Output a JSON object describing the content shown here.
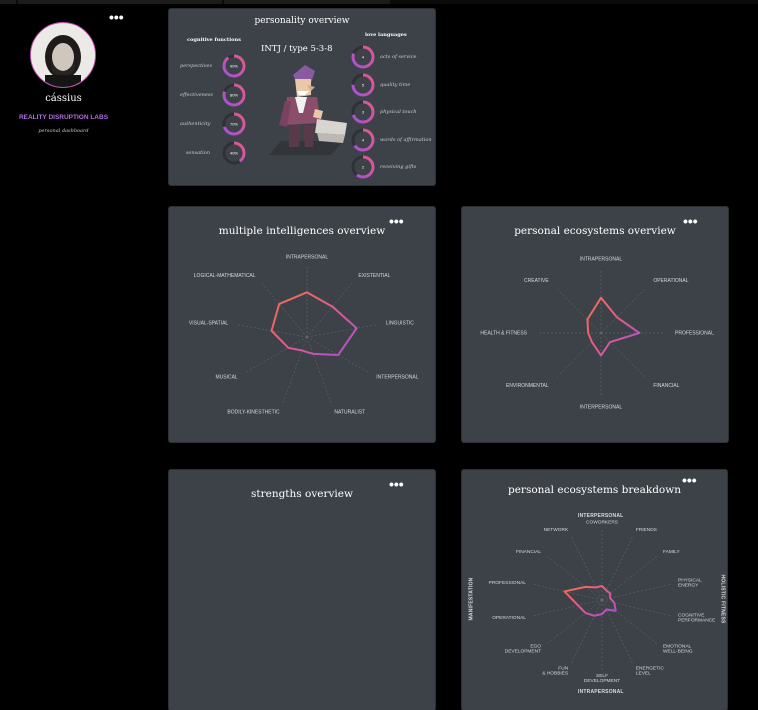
{
  "profile": {
    "name": "cássius",
    "organization": "REALITY DISRUPTION LABS",
    "subtitle": "personal dashboard",
    "menu_icon": "more-dots-icon"
  },
  "personality": {
    "title": "personality overview",
    "type_label": "INTJ / type 5-3-8",
    "cognitive_header": "cognitive functions",
    "cognitive": [
      {
        "label": "perspectives",
        "value": "90%",
        "fraction": 0.9
      },
      {
        "label": "effectiveness",
        "value": "80%",
        "fraction": 0.8
      },
      {
        "label": "authenticity",
        "value": "70%",
        "fraction": 0.7
      },
      {
        "label": "sensation",
        "value": "40%",
        "fraction": 0.4
      }
    ],
    "love_header": "love languages",
    "love": [
      {
        "label": "acts of service",
        "value": "4",
        "fraction": 0.8
      },
      {
        "label": "quality time",
        "value": "5",
        "fraction": 0.75
      },
      {
        "label": "physical touch",
        "value": "3",
        "fraction": 0.7
      },
      {
        "label": "words of affirmation",
        "value": "4",
        "fraction": 0.65
      },
      {
        "label": "receiving gifts",
        "value": "2",
        "fraction": 0.6
      }
    ]
  },
  "intelligences": {
    "title": "multiple intelligences overview",
    "axes": [
      "INTRAPERSONAL",
      "EXISTENTIAL",
      "LINGUISTIC",
      "INTERPERSONAL",
      "NATURALIST",
      "BODILY-KINESTHETIC",
      "MUSICAL",
      "VISUAL-SPATIAL",
      "LOGICAL-MATHEMATICAL"
    ]
  },
  "ecosystems": {
    "title": "personal ecosystems overview",
    "axes": [
      "INTRAPERSONAL",
      "OPERATIONAL",
      "PROFESSIONAL",
      "FINANCIAL",
      "INTERPERSONAL",
      "ENVIRONMENTAL",
      "HEALTH & FITNESS",
      "CREATIVE"
    ]
  },
  "strengths": {
    "title": "strengths overview"
  },
  "breakdown": {
    "title": "personal ecosystems breakdown",
    "top_label": "INTERPERSONAL",
    "bottom_label": "INTRAPERSONAL",
    "left_label": "MANIFESTATION",
    "right_label": "HOLISTIC FITNESS",
    "axes": [
      "COWORKERS",
      "FRIENDS",
      "FAMILY",
      "PHYSICAL ENERGY",
      "COGNITIVE PERFORMANCE",
      "EMOTIONAL WELL-BEING",
      "ENERGETIC LEVEL",
      "SELF DEVELOPMENT",
      "FUN & HOBBIES",
      "EGO DEVELOPMENT",
      "OPERATIONAL",
      "PROFESSIONAL",
      "FINANCIAL",
      "NETWORK"
    ]
  },
  "colors": {
    "accent_purple": "#a64fd9",
    "accent_pink": "#e45a8a",
    "ring_orange": "#f07050",
    "card_bg": "#3d4248"
  },
  "charts": {
    "intelligences_values": [
      0.62,
      0.55,
      0.7,
      0.5,
      0.25,
      0.2,
      0.3,
      0.5,
      0.6
    ],
    "ecosystems_values": [
      0.55,
      0.35,
      0.6,
      0.2,
      0.35,
      0.2,
      0.2,
      0.3
    ],
    "breakdown_values": [
      0.2,
      0.15,
      0.15,
      0.12,
      0.18,
      0.25,
      0.15,
      0.2,
      0.25,
      0.3,
      0.35,
      0.55,
      0.3,
      0.2
    ]
  }
}
